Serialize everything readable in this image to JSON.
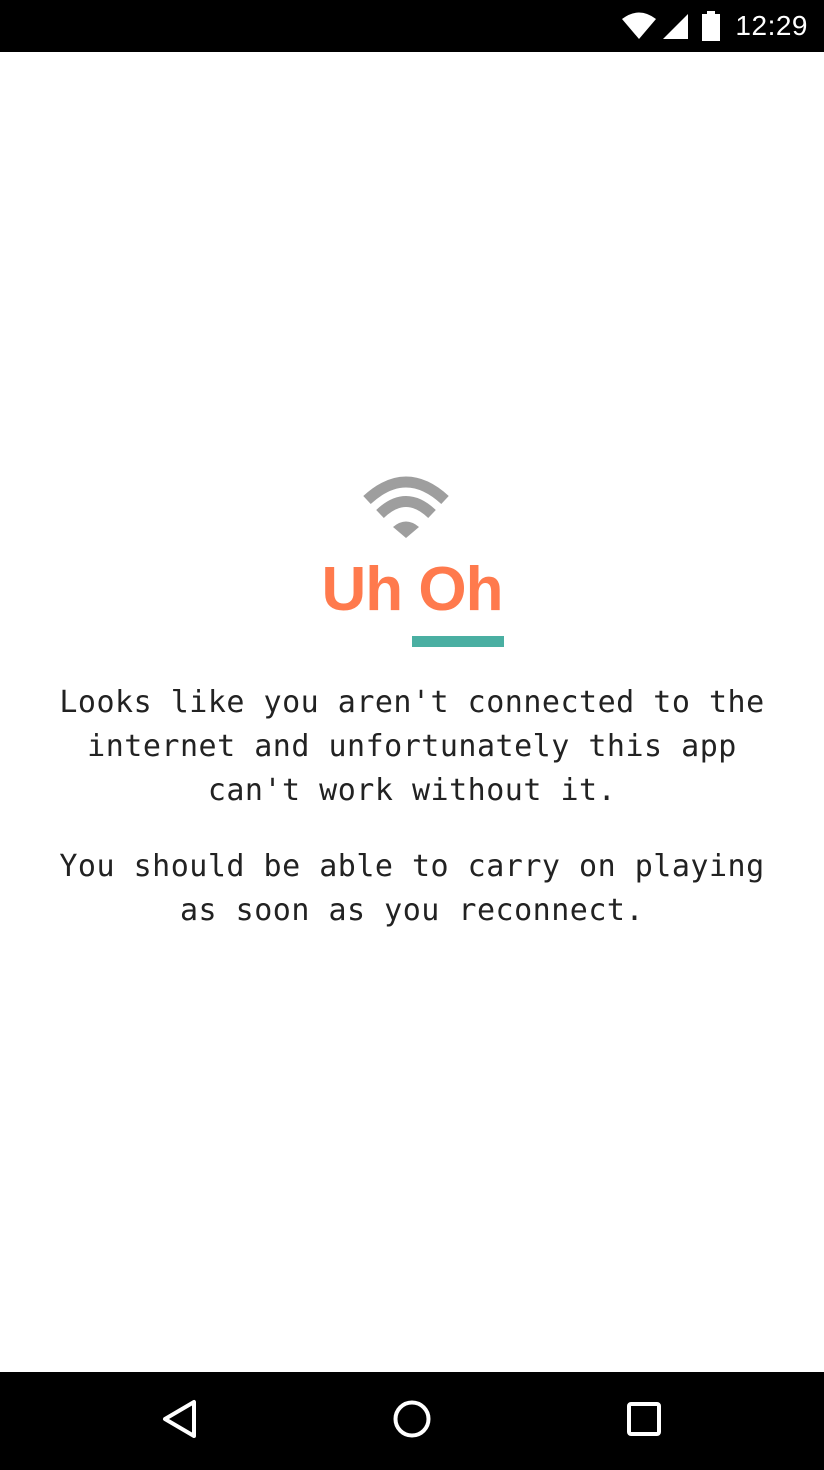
{
  "status_bar": {
    "time": "12:29",
    "icons": [
      "wifi-icon",
      "signal-icon",
      "battery-icon"
    ]
  },
  "error": {
    "icon": "wifi-icon",
    "title": "Uh Oh",
    "message_1": "Looks like you aren't connected to the internet and unfortunately this app can't work without it.",
    "message_2": "You should be able to carry on playing as soon as you reconnect."
  },
  "colors": {
    "title": "#ff7a4d",
    "accent_line": "#4aafa2",
    "icon_gray": "#9e9e9e",
    "body_text": "#222222"
  },
  "nav_bar": {
    "buttons": [
      "back-icon",
      "home-icon",
      "recents-icon"
    ]
  }
}
